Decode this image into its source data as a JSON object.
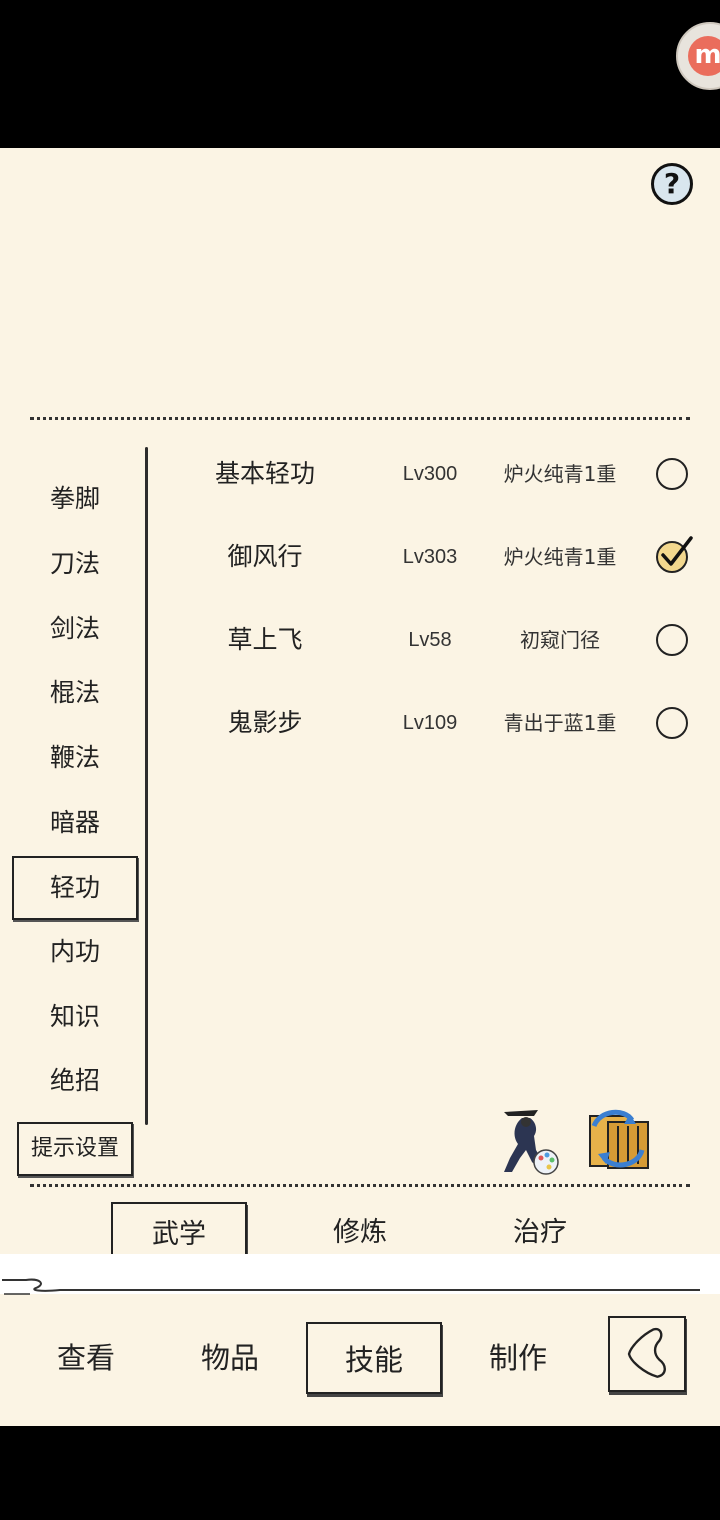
{
  "help": {
    "glyph": "?"
  },
  "badge": {
    "glyph": "m"
  },
  "categories": [
    {
      "label": "拳脚"
    },
    {
      "label": "刀法"
    },
    {
      "label": "剑法"
    },
    {
      "label": "棍法"
    },
    {
      "label": "鞭法"
    },
    {
      "label": "暗器"
    },
    {
      "label": "轻功",
      "active": true
    },
    {
      "label": "内功"
    },
    {
      "label": "知识"
    },
    {
      "label": "绝招"
    }
  ],
  "tip_button": "提示设置",
  "skills": [
    {
      "name": "基本轻功",
      "level": "Lv300",
      "realm": "炉火纯青1重",
      "selected": false
    },
    {
      "name": "御风行",
      "level": "Lv303",
      "realm": "炉火纯青1重",
      "selected": true
    },
    {
      "name": "草上飞",
      "level": "Lv58",
      "realm": "初窥门径",
      "selected": false
    },
    {
      "name": "鬼影步",
      "level": "Lv109",
      "realm": "青出于蓝1重",
      "selected": false
    }
  ],
  "sub_tabs": [
    {
      "label": "武学",
      "active": true
    },
    {
      "label": "修炼"
    },
    {
      "label": "治疗"
    }
  ],
  "nav_tabs": [
    {
      "label": "查看"
    },
    {
      "label": "物品"
    },
    {
      "label": "技能",
      "active": true
    },
    {
      "label": "制作"
    }
  ]
}
